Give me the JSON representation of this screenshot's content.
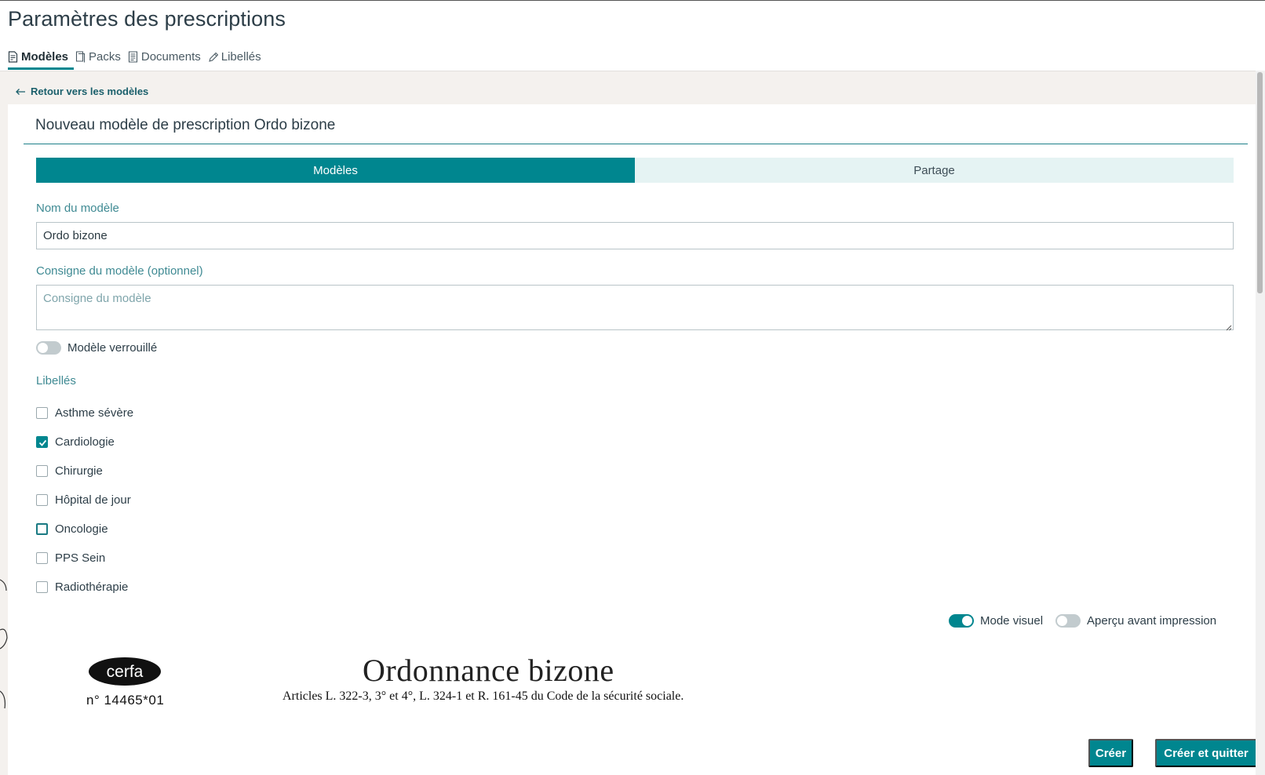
{
  "page": {
    "title": "Paramètres des prescriptions"
  },
  "top_tabs": [
    {
      "label": "Modèles",
      "icon": "document-edit-icon",
      "active": true
    },
    {
      "label": "Packs",
      "icon": "pages-icon",
      "active": false
    },
    {
      "label": "Documents",
      "icon": "document-icon",
      "active": false
    },
    {
      "label": "Libellés",
      "icon": "pencil-icon",
      "active": false
    }
  ],
  "back_link": {
    "label": "Retour vers les modèles"
  },
  "form": {
    "title": "Nouveau modèle de prescription Ordo bizone",
    "segments": [
      {
        "label": "Modèles",
        "active": true
      },
      {
        "label": "Partage",
        "active": false
      }
    ],
    "name": {
      "label": "Nom du modèle",
      "value": "Ordo bizone"
    },
    "instructions": {
      "label": "Consigne du modèle (optionnel)",
      "placeholder": "Consigne du modèle",
      "value": ""
    },
    "locked": {
      "label": "Modèle verrouillé",
      "on": false
    },
    "labels_title": "Libellés",
    "labels": [
      {
        "label": "Asthme sévère",
        "checked": false
      },
      {
        "label": "Cardiologie",
        "checked": true
      },
      {
        "label": "Chirurgie",
        "checked": false
      },
      {
        "label": "Hôpital de jour",
        "checked": false
      },
      {
        "label": "Oncologie",
        "checked": false,
        "focused": true
      },
      {
        "label": "PPS Sein",
        "checked": false
      },
      {
        "label": "Radiothérapie",
        "checked": false
      }
    ],
    "visual_mode": {
      "label": "Mode visuel",
      "on": true
    },
    "print_preview": {
      "label": "Aperçu avant impression",
      "on": false
    }
  },
  "document_preview": {
    "logo_text": "cerfa",
    "cerfa_number": "n° 14465*01",
    "title": "Ordonnance bizone",
    "subtitle": "Articles L. 322-3, 3° et 4°, L. 324-1 et R. 161-45 du Code de la sécurité sociale."
  },
  "actions": {
    "create": "Créer",
    "create_and_quit": "Créer et quitter"
  },
  "colors": {
    "accent": "#00868f",
    "accent_light": "#e5f3f3",
    "background_band": "#f4f1ee",
    "label_teal": "#3f8a93"
  }
}
